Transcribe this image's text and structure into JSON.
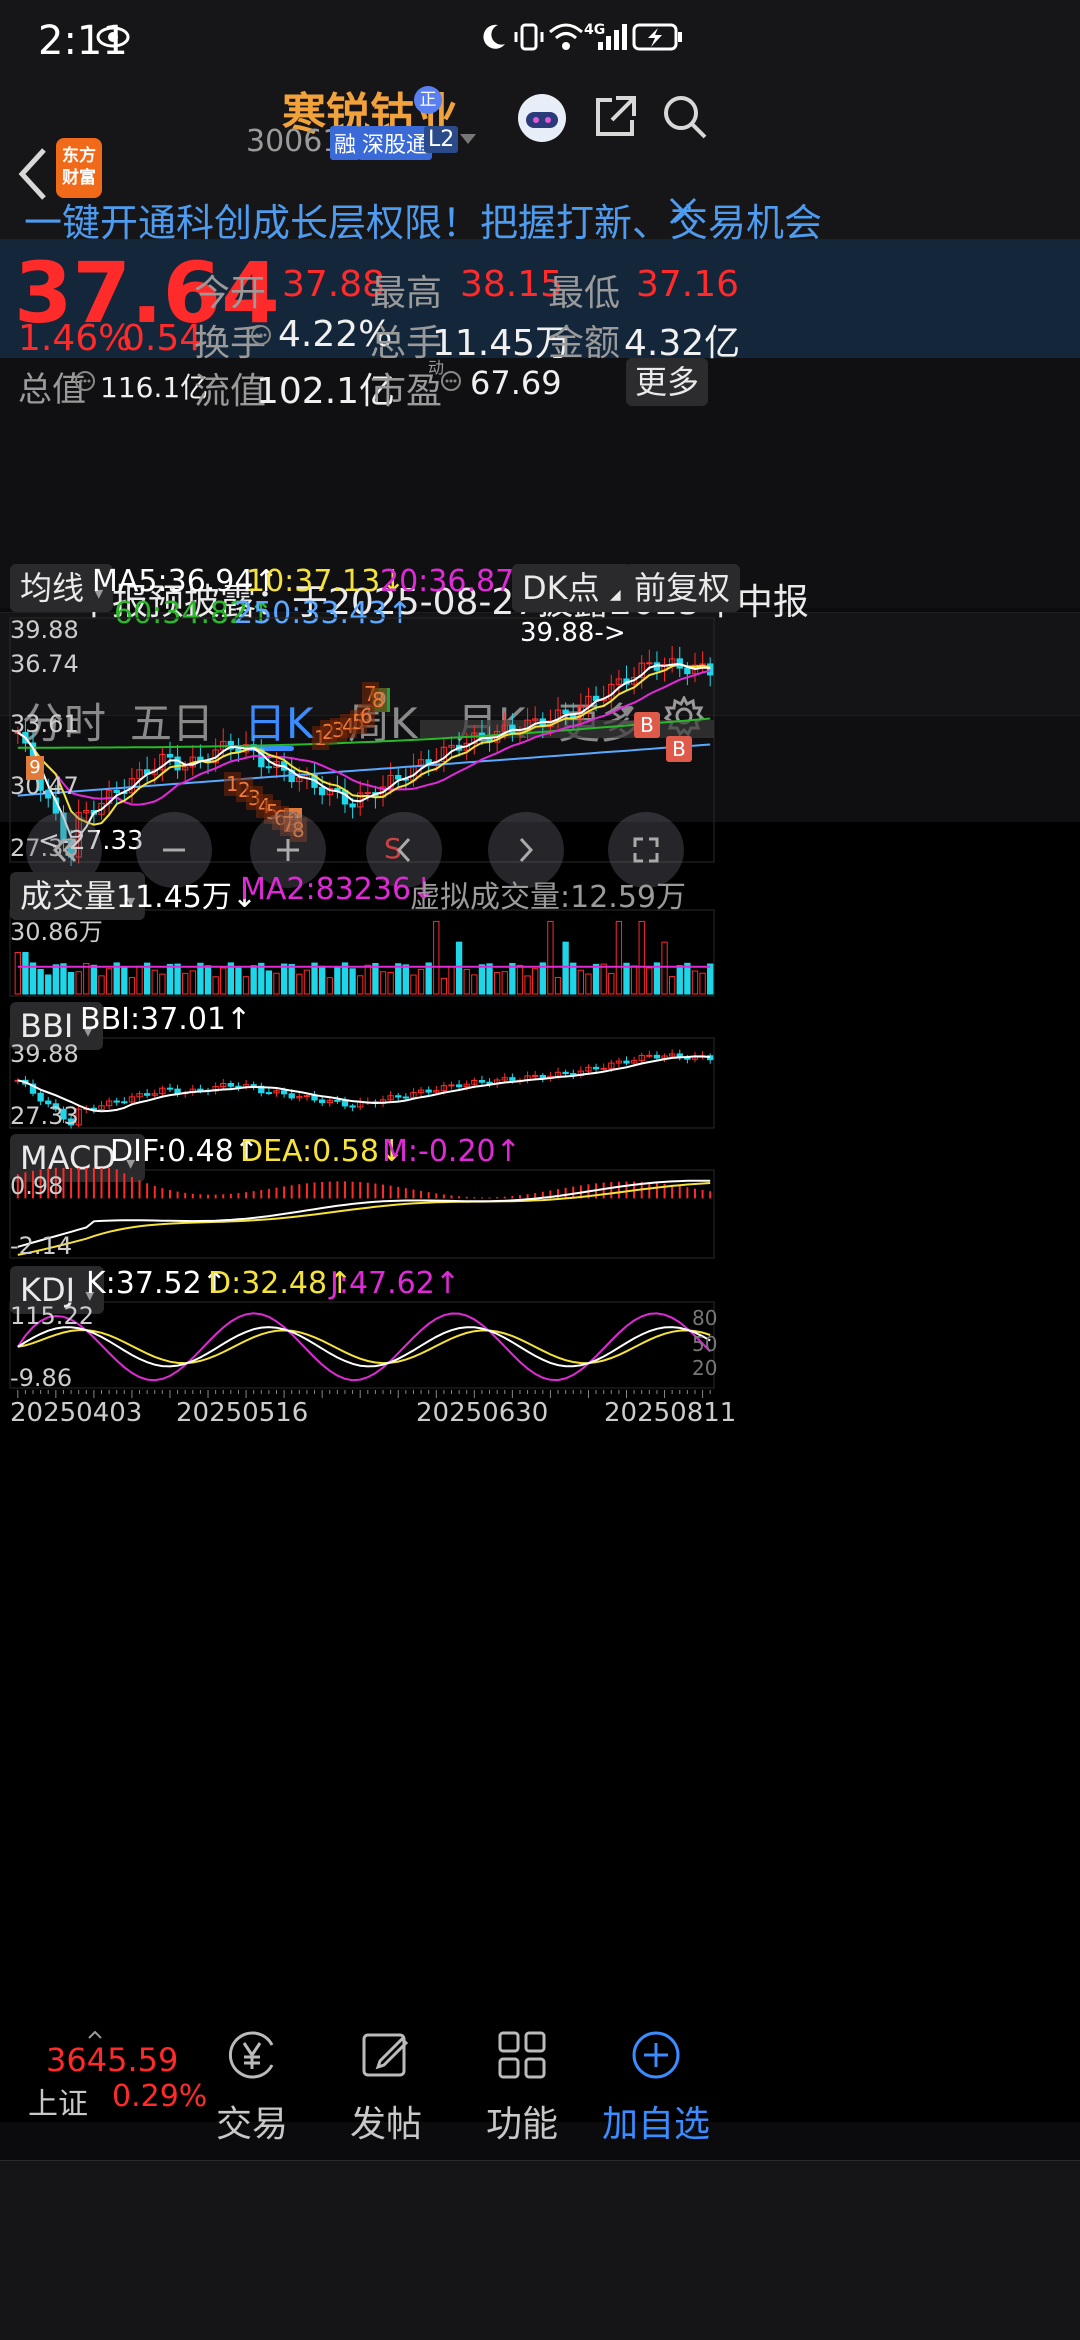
{
  "status_bar": {
    "time": "2:11",
    "network": "4G"
  },
  "header": {
    "logo_line1": "东方",
    "logo_line2": "财富",
    "stock_name": "寒锐钴业",
    "badge_zheng": "正",
    "code": "300618",
    "tag_rong": "融",
    "tag_sgt": "深股通",
    "tag_level": "L2"
  },
  "banner": {
    "text": "一键开通科创成长层权限！把握打新、交易机会"
  },
  "quote": {
    "price": "37.64",
    "change_pct": "1.46%",
    "change_amt": "0.54",
    "fields": [
      {
        "label": "今开",
        "value": "37.88"
      },
      {
        "label": "最高",
        "value": "38.15"
      },
      {
        "label": "最低",
        "value": "37.16"
      },
      {
        "label": "换手",
        "value": "4.22%"
      },
      {
        "label": "总手",
        "value": "11.45万"
      },
      {
        "label": "金额",
        "value": "4.32亿"
      },
      {
        "label": "总值",
        "value": "116.1亿"
      },
      {
        "label": "流值",
        "value": "102.1亿"
      },
      {
        "label": "市盈",
        "sup": "动",
        "value": "67.69"
      }
    ],
    "more_button": "更多"
  },
  "notice": {
    "text": "中报预披露：于2025-08-27披露2025年中报"
  },
  "tabs": [
    "分时",
    "五日",
    "日K",
    "周K",
    "月K",
    "更多"
  ],
  "active_tab": 2,
  "ma_bar": {
    "selector": "均线",
    "ma5": "MA5:36.94↑",
    "ma10": "10:37.13↓",
    "ma20": "20:36.87↑",
    "ma60": "60:34.82↑",
    "ma250": "250:33.43↑",
    "dk_button": "DK点",
    "adj_button": "前复权"
  },
  "kline": {
    "y_labels": [
      "39.88",
      "36.74",
      "33.61",
      "30.47",
      "27.33"
    ],
    "high_marker": "39.88->",
    "low_marker": "<-27.33",
    "sell_marker": "S",
    "buy_marker": "B",
    "td_up_counts": [
      "1",
      "2",
      "3",
      "4",
      "5",
      "6",
      "7",
      "8",
      "9"
    ],
    "td_down_counts": [
      "1",
      "2",
      "3",
      "4",
      "5",
      "6",
      "7",
      "8",
      "9"
    ],
    "td_top_nine": "9"
  },
  "volume": {
    "selector": "成交量",
    "value": "11.45万↓",
    "ma2": "MA2:83236↓",
    "virtual": "虚拟成交量:12.59万",
    "y_max": "30.86万"
  },
  "bbi": {
    "selector": "BBI",
    "value": "BBI:37.01↑",
    "y_top": "39.88",
    "y_bottom": "27.33"
  },
  "macd": {
    "selector": "MACD",
    "dif": "DIF:0.48↑",
    "dea": "DEA:0.58↓",
    "m": "M:-0.20↑",
    "y_top": "0.98",
    "y_bottom": "-2.14"
  },
  "kdj": {
    "selector": "KDJ",
    "k": "K:37.52↑",
    "d": "D:32.48↑",
    "j": "J:47.62↑",
    "y_top": "115.22",
    "y_bottom": "-9.86",
    "levels": [
      "80",
      "50",
      "20"
    ]
  },
  "x_axis": [
    "20250403",
    "20250516",
    "20250630",
    "20250811"
  ],
  "bottom_nav": {
    "index_value": "3645.59",
    "index_name": "上证",
    "index_change": "0.29%",
    "items": [
      "交易",
      "发帖",
      "功能",
      "加自选"
    ]
  },
  "colors": {
    "up": "#ff2a2a",
    "down": "#1fd6e8",
    "ma5": "#ffffff",
    "ma10": "#f5e23a",
    "ma20": "#e02ad8",
    "ma60": "#2ab82a",
    "ma250": "#5aa8ff",
    "accent": "#3a8cff"
  }
}
